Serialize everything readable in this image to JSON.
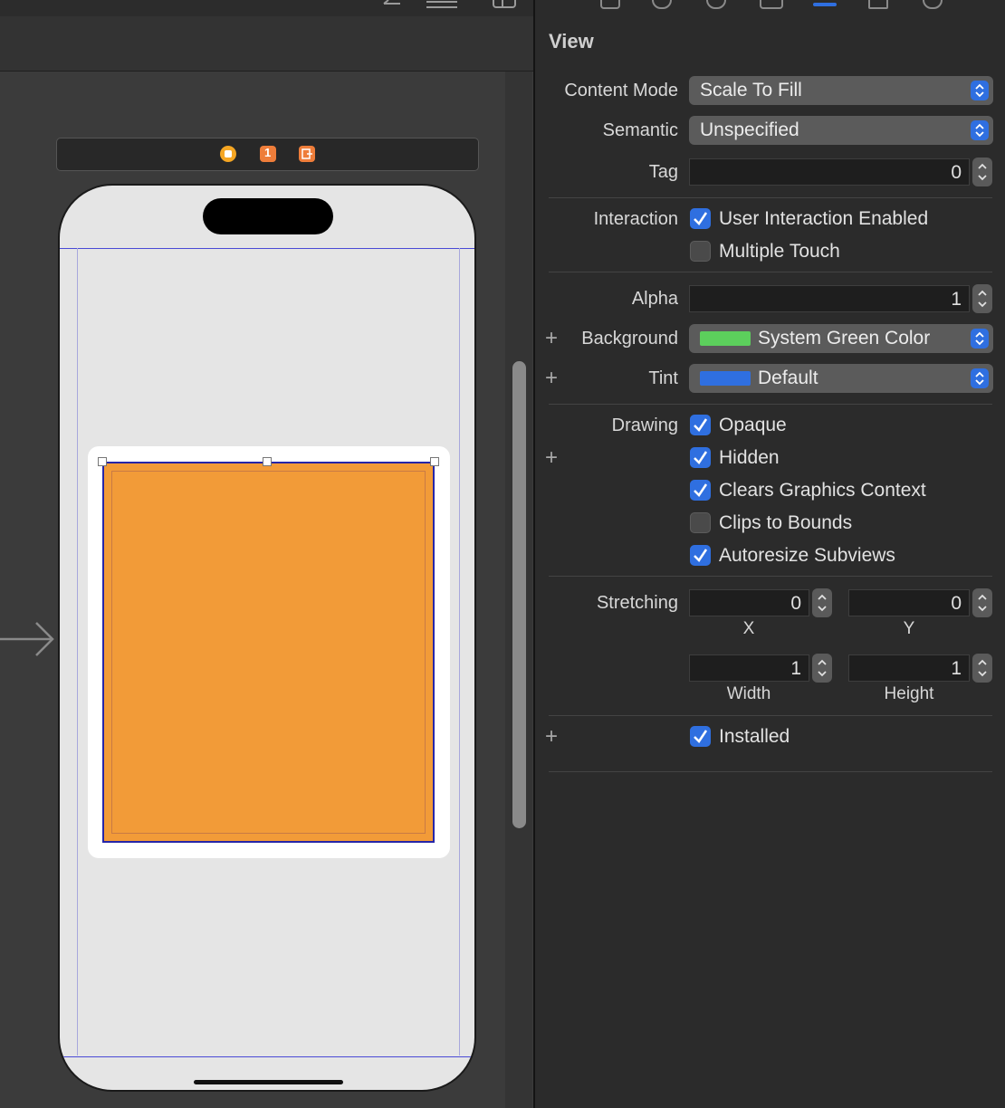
{
  "canvas": {
    "toolbar_icons": [
      "back-arrow-icon",
      "lines-icon",
      "panel-icon"
    ],
    "scene_icons": [
      {
        "name": "view-controller-icon",
        "color": "#f5a623"
      },
      {
        "name": "first-responder-icon",
        "color": "#ee7d3a",
        "label": "1"
      },
      {
        "name": "exit-icon",
        "color": "#ee7d3a"
      }
    ],
    "phone_background": "#e5e5e5",
    "card_color": "#ffffff",
    "selected_view_color": "#f29b38"
  },
  "inspector": {
    "tab_icons": [
      "file-icon",
      "history-icon",
      "help-icon",
      "identity-icon",
      "attributes-icon",
      "size-icon",
      "connections-icon"
    ],
    "section_title": "View",
    "content_mode": {
      "label": "Content Mode",
      "value": "Scale To Fill"
    },
    "semantic": {
      "label": "Semantic",
      "value": "Unspecified"
    },
    "tag": {
      "label": "Tag",
      "value": "0"
    },
    "interaction": {
      "label": "Interaction",
      "options": [
        {
          "label": "User Interaction Enabled",
          "checked": true
        },
        {
          "label": "Multiple Touch",
          "checked": false
        }
      ]
    },
    "alpha": {
      "label": "Alpha",
      "value": "1"
    },
    "background": {
      "label": "Background",
      "value": "System Green Color",
      "swatch": "#5ccf5c"
    },
    "tint": {
      "label": "Tint",
      "value": "Default",
      "swatch": "#2f6fe0"
    },
    "drawing": {
      "label": "Drawing",
      "options": [
        {
          "label": "Opaque",
          "checked": true
        },
        {
          "label": "Hidden",
          "checked": true
        },
        {
          "label": "Clears Graphics Context",
          "checked": true
        },
        {
          "label": "Clips to Bounds",
          "checked": false
        },
        {
          "label": "Autoresize Subviews",
          "checked": true
        }
      ]
    },
    "stretching": {
      "label": "Stretching",
      "x": "0",
      "y": "0",
      "width": "1",
      "height": "1",
      "x_label": "X",
      "y_label": "Y",
      "width_label": "Width",
      "height_label": "Height"
    },
    "installed": {
      "label": "Installed",
      "checked": true
    },
    "plus_symbol": "+"
  }
}
